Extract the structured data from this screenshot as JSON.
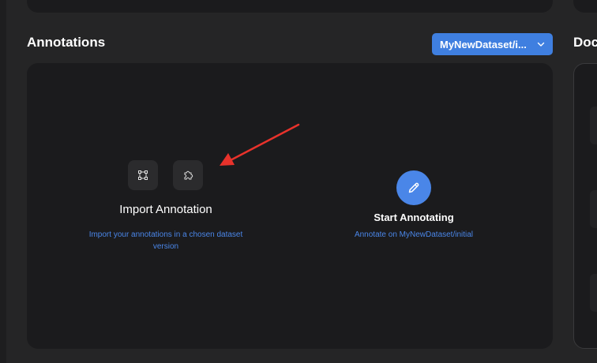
{
  "section": {
    "title": "Annotations"
  },
  "side_panel": {
    "title": "Docu"
  },
  "dataset_select": {
    "value": "MyNewDataset/initial",
    "display": "MyNewDataset/i..."
  },
  "import": {
    "title": "Import Annotation",
    "description": "Import your annotations in a chosen dataset version",
    "icons": [
      "bounding-box-icon",
      "puzzle-icon"
    ]
  },
  "start": {
    "title": "Start Annotating",
    "description": "Annotate on MyNewDataset/initial",
    "icon": "pencil-icon"
  },
  "annotation_overlay": {
    "arrow_color": "#e8322b",
    "arrow_target": "puzzle-icon"
  },
  "colors": {
    "accent": "#4a86e8",
    "card": "#1b1b1d",
    "background": "#252526",
    "button": "#2b2b2d"
  }
}
